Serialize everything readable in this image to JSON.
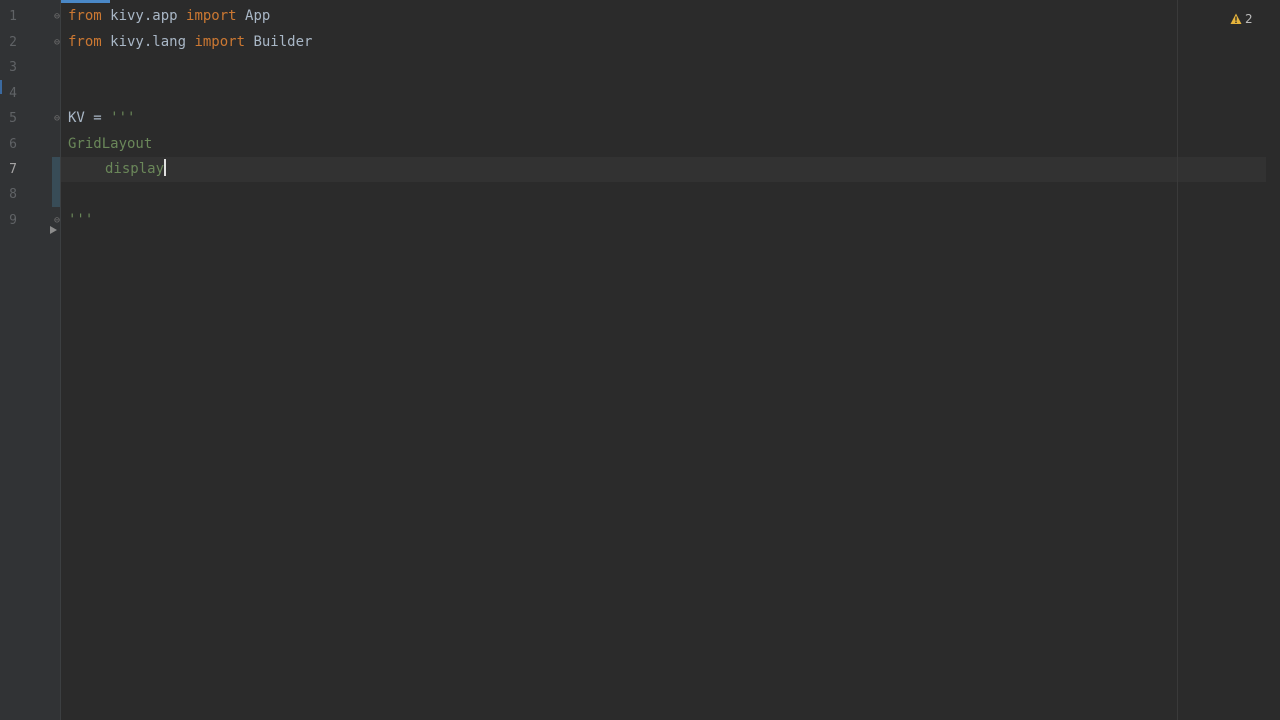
{
  "line_numbers": [
    "1",
    "2",
    "3",
    "4",
    "5",
    "6",
    "7",
    "8",
    "9"
  ],
  "current_line_index": 6,
  "code": {
    "line1": {
      "kw1": "from",
      "mod": " kivy.app ",
      "kw2": "import",
      "name": " App"
    },
    "line2": {
      "kw1": "from",
      "mod": " kivy.lang ",
      "kw2": "import",
      "name": " Builder"
    },
    "line5": {
      "name": "KV",
      "op": " = ",
      "str": "'''"
    },
    "line6": {
      "str": "GridLayout"
    },
    "line7": {
      "str": "display"
    },
    "line9": {
      "str": "'''"
    }
  },
  "inspection": {
    "icon": "warning-triangle-icon",
    "count": "2",
    "color": "#e5b33b"
  },
  "colors": {
    "background": "#2b2b2b",
    "keyword": "#cc7832",
    "string": "#6a8759",
    "text": "#a9b7c6"
  }
}
